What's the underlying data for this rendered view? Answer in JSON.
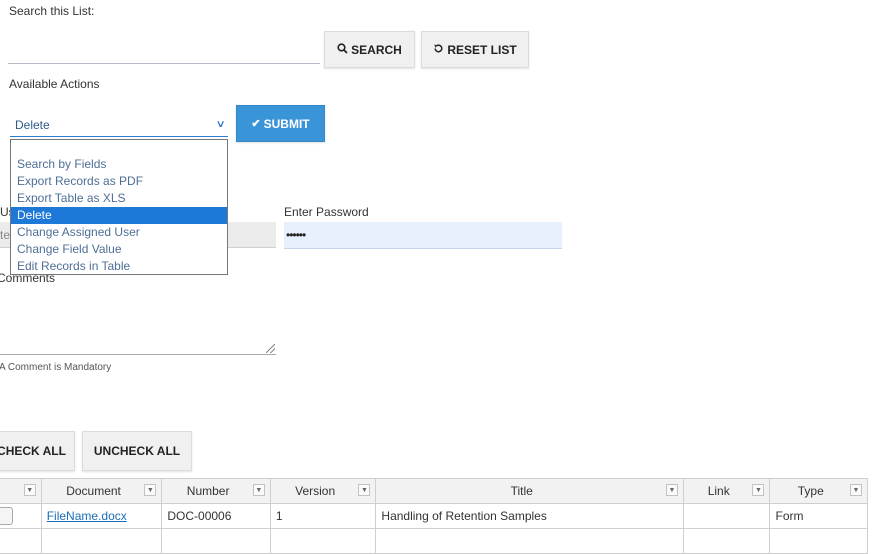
{
  "search": {
    "label": "Search this List:",
    "value": "",
    "search_button": "SEARCH",
    "reset_button": "RESET LIST"
  },
  "actions": {
    "label": "Available Actions",
    "selected": "Delete",
    "submit_button": "SUBMIT",
    "options": [
      "Search by Fields",
      "Export Records as PDF",
      "Export Table as XLS",
      "Delete",
      "Change Assigned User",
      "Change Field Value",
      "Edit Records in Table"
    ],
    "selected_index": 3
  },
  "credentials": {
    "username_label_partial": "Us",
    "username_value_partial": "te",
    "password_label": "Enter Password",
    "password_value": "••••••"
  },
  "comments": {
    "label": "Comments",
    "value": "",
    "note": "A Comment is Mandatory"
  },
  "check": {
    "check_all": "CHECK ALL",
    "uncheck_all": "UNCHECK ALL"
  },
  "table": {
    "columns": [
      "",
      "Document",
      "Number",
      "Version",
      "Title",
      "Link",
      "Type"
    ],
    "rows": [
      {
        "document": "FileName.docx",
        "number": "DOC-00006",
        "version": "1",
        "title": "Handling of Retention Samples",
        "link": "",
        "type": "Form"
      }
    ]
  },
  "icons": {
    "search": "search-icon",
    "reset": "reset-icon",
    "submit": "check-icon",
    "select": "chevron-down-icon",
    "filter": "filter-dropdown-icon"
  },
  "colors": {
    "submit": "#3a95d8",
    "selected_option": "#1e78d7",
    "link": "#1a6fb8",
    "password_field": "#e8f0fd"
  }
}
